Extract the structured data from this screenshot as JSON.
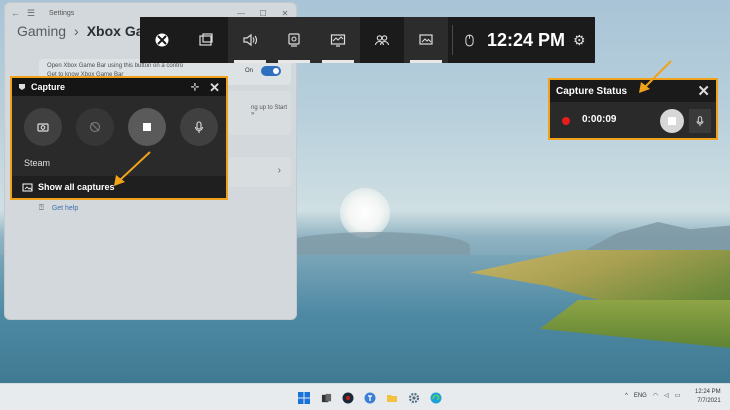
{
  "settings": {
    "app_name": "Settings",
    "back_glyph": "←",
    "menu_glyph": "☰",
    "min_glyph": "—",
    "max_glyph": "☐",
    "close_glyph": "✕",
    "crumb_parent": "Gaming",
    "crumb_sep": "›",
    "crumb_current": "Xbox Game",
    "toggle_line1": "Open Xbox Game Bar using this button on a contro",
    "toggle_line2": "Get to know Xbox Game Bar",
    "toggle_state": "On",
    "card_hint": "ng up to Start »",
    "chevron": "›",
    "get_help": "Get help"
  },
  "capture_widget": {
    "title": "Capture",
    "pin_glyph": "⊹",
    "close_glyph": "✕",
    "game_name": "Steam",
    "show_all_label": "Show all captures"
  },
  "gamebar": {
    "time": "12:24 PM",
    "gear_glyph": "⚙",
    "icons": [
      "xbox-icon",
      "widget-menu-icon",
      "audio-icon",
      "capture-icon",
      "performance-icon",
      "xbox-social-icon",
      "gallery-icon",
      "mouse-icon"
    ]
  },
  "capture_status": {
    "title": "Capture Status",
    "close_glyph": "✕",
    "recording_time": "0:00:09"
  },
  "taskbar": {
    "tray_lang": "ENG",
    "tray_chevron": "^",
    "clock_time": "12:24 PM",
    "clock_date": "7/7/2021"
  },
  "colors": {
    "highlight": "#f0a21b",
    "recording": "#e81d1d",
    "toggle_on": "#2f6fbf"
  }
}
